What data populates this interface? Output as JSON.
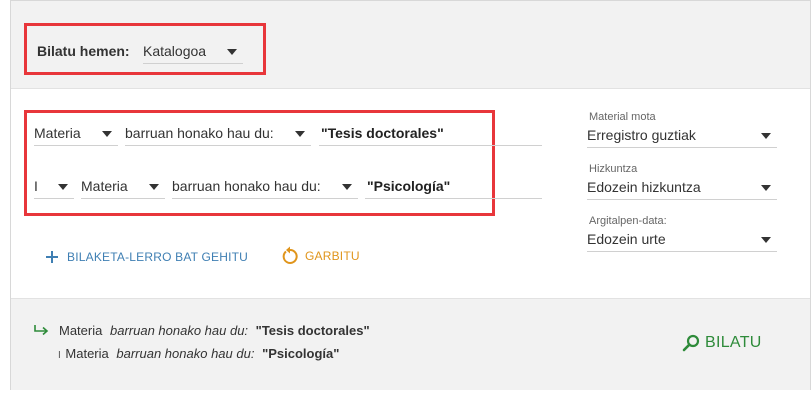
{
  "search_in": {
    "label": "Bilatu hemen:",
    "value": "Katalogoa"
  },
  "rows": [
    {
      "field": "Materia",
      "operator": "barruan honako hau du:",
      "value": "\"Tesis doctorales\""
    },
    {
      "boolean": "I",
      "field": "Materia",
      "operator": "barruan honako hau du:",
      "value": "\"Psicología\""
    }
  ],
  "filters": {
    "material_type": {
      "label": "Material mota",
      "value": "Erregistro guztiak"
    },
    "language": {
      "label": "Hizkuntza",
      "value": "Edozein hizkuntza"
    },
    "pub_date": {
      "label": "Argitalpen-data:",
      "value": "Edozein urte"
    }
  },
  "actions": {
    "add_row": "BILAKETA-LERRO BAT GEHITU",
    "clear": "GARBITU",
    "search": "BILATU"
  },
  "summary": [
    {
      "field": "Materia",
      "operator": "barruan honako hau du:",
      "value": "\"Tesis doctorales\""
    },
    {
      "prefix": "I",
      "field": "Materia",
      "operator": "barruan honako hau du:",
      "value": "\"Psicología\""
    }
  ],
  "colors": {
    "highlight": "#e8363b",
    "add_link": "#3f7fb3",
    "clear": "#e0951c",
    "search": "#2e8b3a"
  }
}
